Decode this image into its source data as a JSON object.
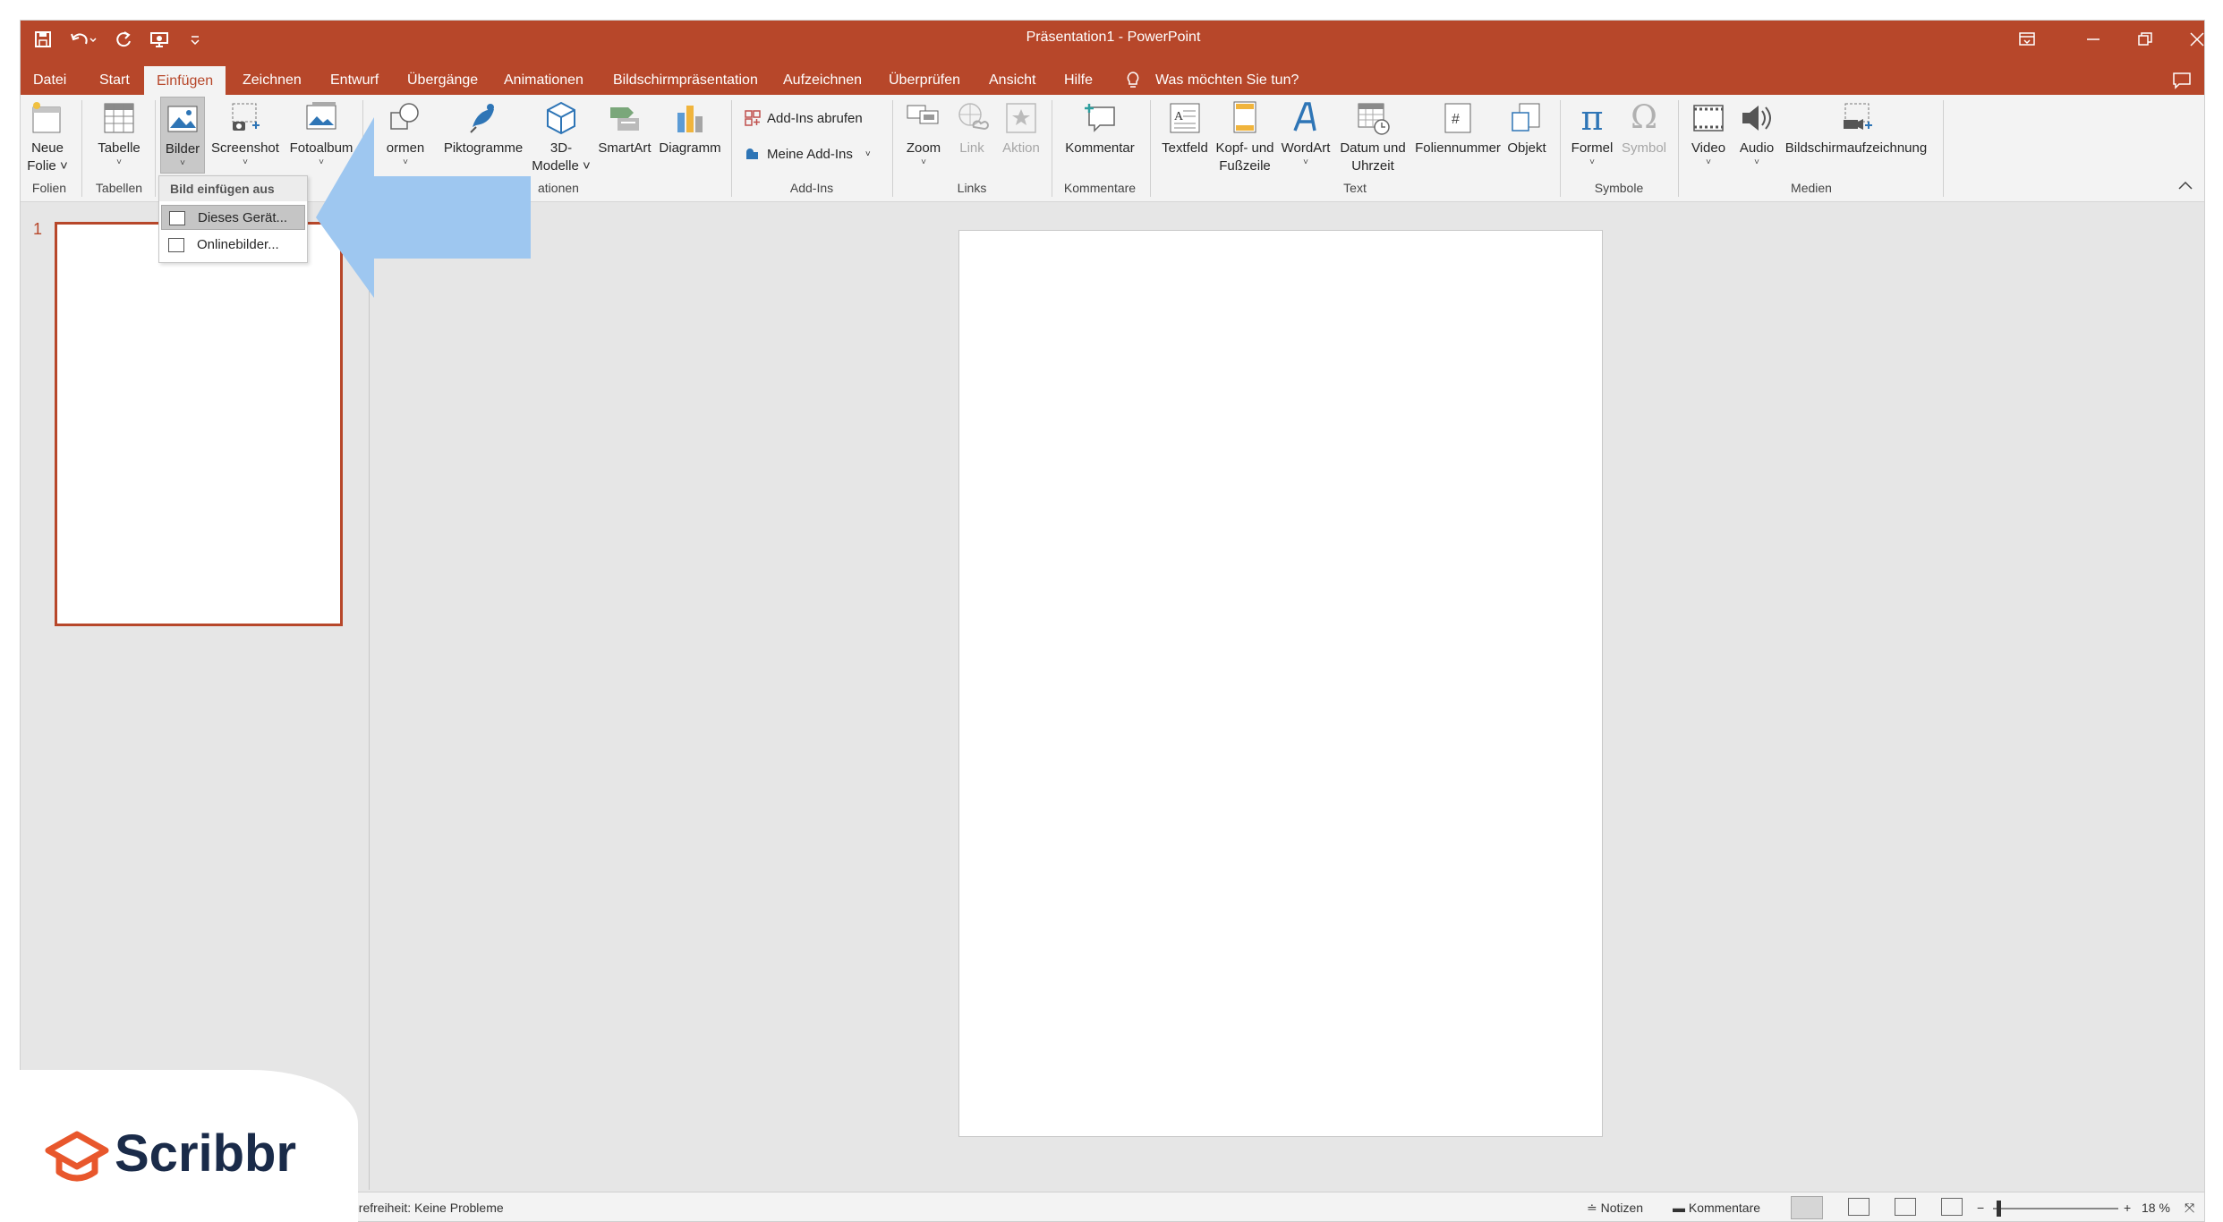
{
  "window": {
    "title": "Präsentation1  -  PowerPoint",
    "qat_icons": [
      "save-icon",
      "undo-icon",
      "redo-icon",
      "presenter-icon",
      "customize-icon"
    ],
    "title_icons": [
      "ribbon-display-icon",
      "minimize-icon",
      "restore-icon",
      "close-icon"
    ],
    "accent": "#b7472a"
  },
  "tabs": [
    {
      "label": "Datei",
      "active": false
    },
    {
      "label": "Start",
      "active": false
    },
    {
      "label": "Einfügen",
      "active": true
    },
    {
      "label": "Zeichnen",
      "active": false
    },
    {
      "label": "Entwurf",
      "active": false
    },
    {
      "label": "Übergänge",
      "active": false
    },
    {
      "label": "Animationen",
      "active": false
    },
    {
      "label": "Bildschirmpräsentation",
      "active": false
    },
    {
      "label": "Aufzeichnen",
      "active": false
    },
    {
      "label": "Überprüfen",
      "active": false
    },
    {
      "label": "Ansicht",
      "active": false
    },
    {
      "label": "Hilfe",
      "active": false
    }
  ],
  "tell_me": "Was möchten Sie tun?",
  "ribbon": {
    "buttons": {
      "neue_folie": [
        "Neue",
        "Folie"
      ],
      "tabelle": "Tabelle",
      "bilder": "Bilder",
      "screenshot": "Screenshot",
      "fotoalbum": "Fotoalbum",
      "formen": "ormen",
      "piktogramme": "Piktogramme",
      "modelle": [
        "3D-",
        "Modelle"
      ],
      "smartart": "SmartArt",
      "diagramm": "Diagramm",
      "addins_abrufen": "Add-Ins abrufen",
      "meine_addins": "Meine Add-Ins",
      "zoom": "Zoom",
      "link": "Link",
      "aktion": "Aktion",
      "kommentar": "Kommentar",
      "textfeld": "Textfeld",
      "kopf_fusszeile": [
        "Kopf- und",
        "Fußzeile"
      ],
      "wordart": "WordArt",
      "datum_uhrzeit": [
        "Datum und",
        "Uhrzeit"
      ],
      "foliennummer": "Foliennummer",
      "objekt": "Objekt",
      "formel": "Formel",
      "symbol": "Symbol",
      "video": "Video",
      "audio": "Audio",
      "bildschirmaufzeichnung": "Bildschirmaufzeichnung"
    },
    "groups": {
      "folien": "Folien",
      "tabellen": "Tabellen",
      "illustrationen": "ationen",
      "addins": "Add-Ins",
      "links": "Links",
      "kommentare": "Kommentare",
      "text": "Text",
      "symbole": "Symbole",
      "medien": "Medien"
    }
  },
  "dropdown": {
    "header": "Bild einfügen aus",
    "items": [
      "Dieses Gerät...",
      "Onlinebilder..."
    ]
  },
  "thumbnails": {
    "slide_number": "1"
  },
  "status": {
    "accessibility": "Barrierefreiheit: Keine Probleme",
    "accessibility_visible": "erefreiheit: Keine Probleme",
    "notizen": "Notizen",
    "kommentare": "Kommentare",
    "zoom": "18 %"
  },
  "watermark": {
    "brand": "Scribbr"
  },
  "colors": {
    "accent": "#b7472a",
    "arrow": "#9ec7f0",
    "logo_orange": "#e8572c",
    "logo_navy": "#1a2b49"
  }
}
